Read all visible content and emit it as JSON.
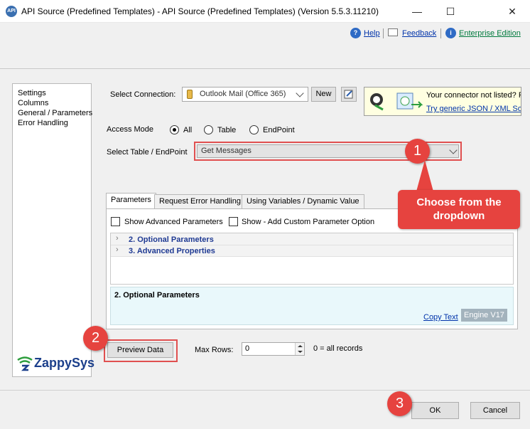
{
  "window": {
    "title": "API Source (Predefined Templates) - API Source (Predefined Templates) (Version 5.5.3.11210)",
    "app_icon_label": "API",
    "minimize": "—",
    "maximize": "☐",
    "close": "✕"
  },
  "helpbar": {
    "help": "Help",
    "feedback": "Feedback",
    "edition": "Enterprise Edition"
  },
  "nav": {
    "items": [
      {
        "label": "Settings"
      },
      {
        "label": "Columns"
      },
      {
        "label": "General / Parameters"
      },
      {
        "label": "Error Handling"
      }
    ]
  },
  "connection": {
    "label": "Select Connection:",
    "value": "Outlook Mail (Office 365)",
    "new_label": "New"
  },
  "banner": {
    "line1": "Your connector not listed? Re",
    "line2": "Try generic JSON / XML Sour"
  },
  "access": {
    "label": "Access Mode",
    "options": [
      "All",
      "Table",
      "EndPoint"
    ],
    "selected": "All"
  },
  "table": {
    "label": "Select Table / EndPoint",
    "value": "Get Messages"
  },
  "tabs": [
    {
      "label": "Parameters"
    },
    {
      "label": "Request Error Handling"
    },
    {
      "label": "Using Variables / Dynamic Value"
    }
  ],
  "params": {
    "show_advanced": "Show Advanced Parameters",
    "show_custom": "Show - Add Custom Parameter Option",
    "groups": [
      {
        "label": "2. Optional Parameters"
      },
      {
        "label": "3. Advanced Properties"
      }
    ],
    "desc_title": "2. Optional Parameters",
    "copy_text": "Copy Text",
    "engine": "Engine V17"
  },
  "preview": {
    "button": "Preview Data",
    "max_rows_label": "Max Rows:",
    "max_rows_value": "0",
    "hint": "0 = all records"
  },
  "logo": {
    "text": "ZappySys"
  },
  "footer": {
    "ok": "OK",
    "cancel": "Cancel"
  },
  "annotations": {
    "step1": "1",
    "step2": "2",
    "step3": "3",
    "tooltip": "Choose from the dropdown"
  },
  "colors": {
    "accent_red": "#e6433f",
    "link_blue": "#0033aa",
    "group_blue": "#1f3a93",
    "banner_yellow": "#ffffe1",
    "desc_bg": "#e9f8fb"
  }
}
